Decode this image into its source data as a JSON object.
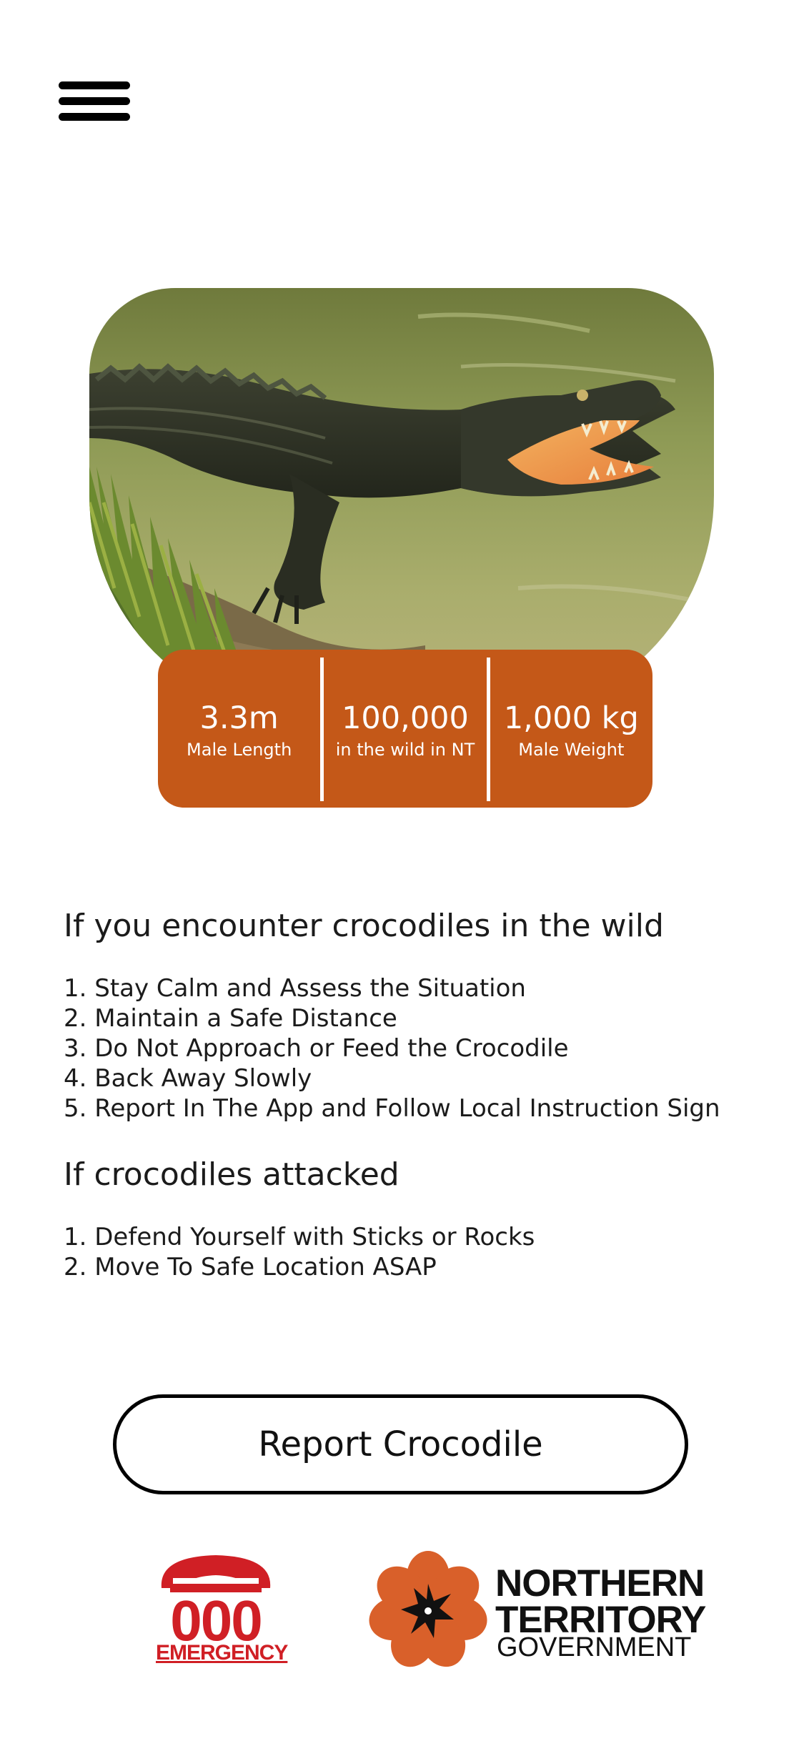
{
  "header": {
    "menu_icon": "hamburger-menu-icon"
  },
  "hero": {
    "image": "saltwater-crocodile-photo"
  },
  "stats": [
    {
      "value": "3.3m",
      "label": "Male Length"
    },
    {
      "value": "100,000",
      "label": "in the wild in NT"
    },
    {
      "value": "1,000 kg",
      "label": "Male Weight"
    }
  ],
  "encounter": {
    "title": "If you encounter crocodiles in the wild",
    "items": [
      "1. Stay Calm and Assess the Situation",
      "2. Maintain a Safe Distance",
      "3. Do Not Approach or Feed the Crocodile",
      "4. Back Away Slowly",
      "5. Report In The App and Follow Local Instruction Sign"
    ]
  },
  "attack": {
    "title": "If crocodiles attacked",
    "items": [
      "1. Defend Yourself with Sticks or Rocks",
      "2. Move To Safe Location ASAP"
    ]
  },
  "report_button": {
    "label": "Report Crocodile"
  },
  "logos": {
    "emergency": {
      "digits": "000",
      "word": "EMERGENCY",
      "icon": "telephone-icon"
    },
    "nt_government": {
      "line1": "NORTHERN",
      "line2": "TERRITORY",
      "line3": "GOVERNMENT",
      "icon": "nt-flower-emblem"
    }
  },
  "colors": {
    "accent": "#C45818",
    "emergency_red": "#D01F25",
    "text": "#1B1B1B"
  }
}
